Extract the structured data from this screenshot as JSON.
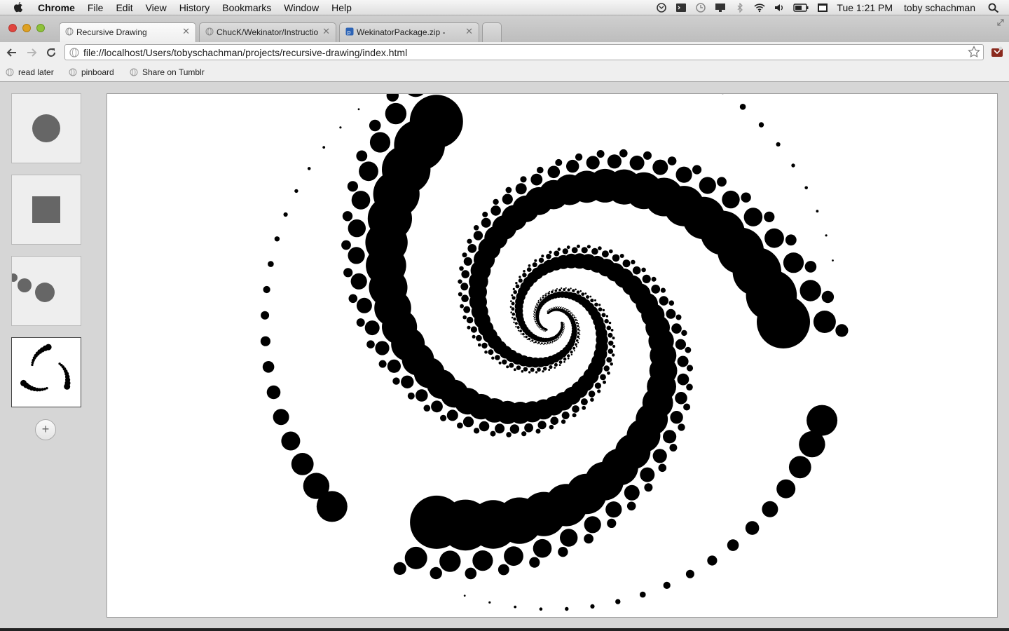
{
  "menubar": {
    "app_name": "Chrome",
    "items": [
      "File",
      "Edit",
      "View",
      "History",
      "Bookmarks",
      "Window",
      "Help"
    ],
    "clock": "Tue 1:21 PM",
    "user": "toby schachman",
    "status_icons": [
      "time-machine-icon",
      "terminal-icon",
      "clock-icon",
      "display-icon",
      "bluetooth-icon",
      "wifi-icon",
      "volume-icon",
      "battery-icon",
      "calendar-icon",
      "spotlight-icon"
    ]
  },
  "tabs": [
    {
      "title": "Recursive Drawing",
      "active": true
    },
    {
      "title": "ChucK/Wekinator/Instructio",
      "active": false
    },
    {
      "title": "WekinatorPackage.zip - wek",
      "active": false
    }
  ],
  "toolbar": {
    "url": "file://localhost/Users/tobyschachman/projects/recursive-drawing/index.html"
  },
  "bookmarks": [
    "read later",
    "pinboard",
    "Share on Tumblr"
  ],
  "app": {
    "thumbnails": [
      {
        "name": "circle",
        "selected": false
      },
      {
        "name": "square",
        "selected": false
      },
      {
        "name": "circles-recursive",
        "selected": false
      },
      {
        "name": "spiral-drawing",
        "selected": true
      }
    ],
    "add_label": "+"
  },
  "colors": {
    "shape_gray": "#666666",
    "drawing": "#000000",
    "canvas_bg": "#ffffff",
    "chrome_bg": "#d6d6d6"
  }
}
